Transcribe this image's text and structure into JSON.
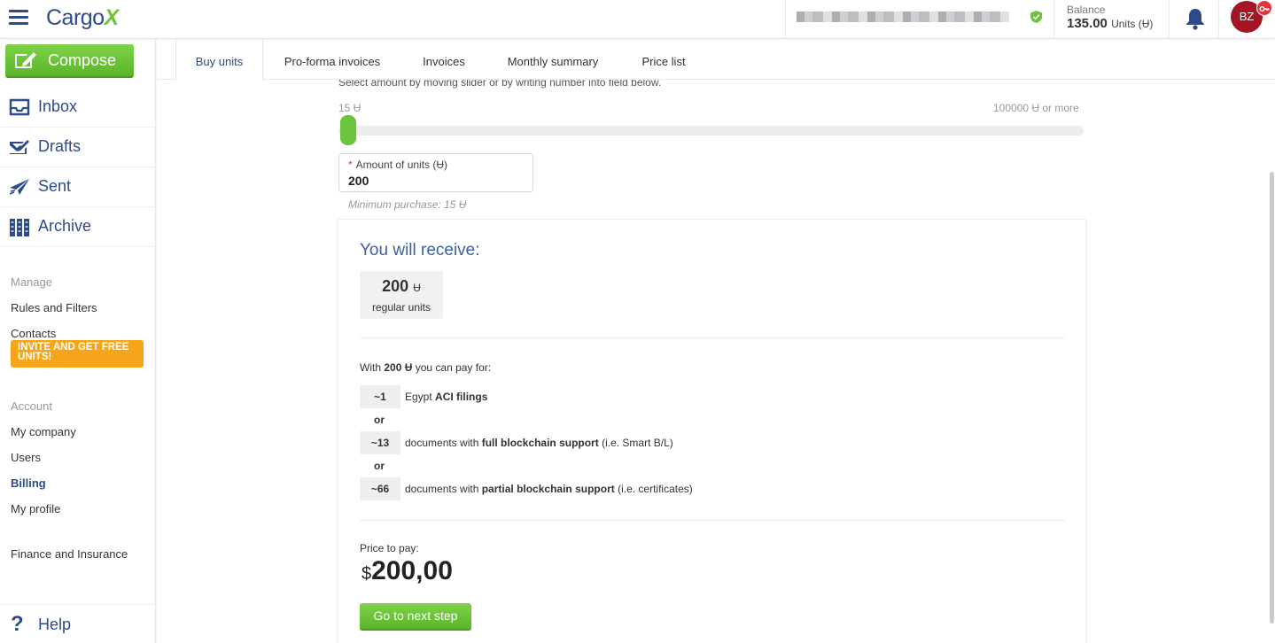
{
  "header": {
    "logo_text": "Cargo",
    "logo_accent": "X",
    "balance_label": "Balance",
    "balance_value": "135.00",
    "balance_unit": "Units (Ʉ)",
    "avatar_initials": "BZ"
  },
  "sidebar": {
    "compose_label": "Compose",
    "nav": [
      {
        "label": "Inbox",
        "icon": "inbox-icon"
      },
      {
        "label": "Drafts",
        "icon": "drafts-icon"
      },
      {
        "label": "Sent",
        "icon": "sent-icon"
      },
      {
        "label": "Archive",
        "icon": "archive-icon"
      }
    ],
    "manage_label": "Manage",
    "rules_label": "Rules and Filters",
    "contacts_label": "Contacts",
    "invite_label": "INVITE AND GET FREE UNITS!",
    "account_label": "Account",
    "my_company_label": "My company",
    "users_label": "Users",
    "billing_label": "Billing",
    "my_profile_label": "My profile",
    "finance_label": "Finance and Insurance",
    "help_label": "Help"
  },
  "tabs": [
    "Buy units",
    "Pro-forma invoices",
    "Invoices",
    "Monthly summary",
    "Price list"
  ],
  "buy": {
    "instruction": "Select amount by moving slider or by writing number into field below.",
    "slider_min_label": "15 Ʉ",
    "slider_max_label": "100000 Ʉ or more",
    "slider_value": 200,
    "amount_label": "Amount of units (Ʉ)",
    "amount_required": "*",
    "amount_value": "200",
    "min_purchase": "Minimum purchase: 15 Ʉ"
  },
  "receive": {
    "title": "You will receive:",
    "units_number": "200",
    "units_symbol": "Ʉ",
    "units_sub": "regular units",
    "pay_for_prefix": "With ",
    "pay_for_amount": "200",
    "pay_for_symbol": " Ʉ",
    "pay_for_suffix": " you can pay for:",
    "items": [
      {
        "qty": "~1",
        "pre": "Egypt ",
        "bold": "ACI filings",
        "post": ""
      },
      {
        "qty": "~13",
        "pre": "documents with ",
        "bold": "full blockchain support",
        "post": " (i.e. Smart B/L)"
      },
      {
        "qty": "~66",
        "pre": "documents with ",
        "bold": "partial blockchain support",
        "post": " (i.e. certificates)"
      }
    ],
    "or_label": "or",
    "price_label": "Price to pay:",
    "price_currency": "$",
    "price_value": "200,00",
    "next_label": "Go to next step"
  },
  "colors": {
    "brand_blue": "#2d4a8a",
    "accent_green": "#6cc43c",
    "invite_orange": "#f6a51b",
    "avatar_red": "#a41525"
  }
}
